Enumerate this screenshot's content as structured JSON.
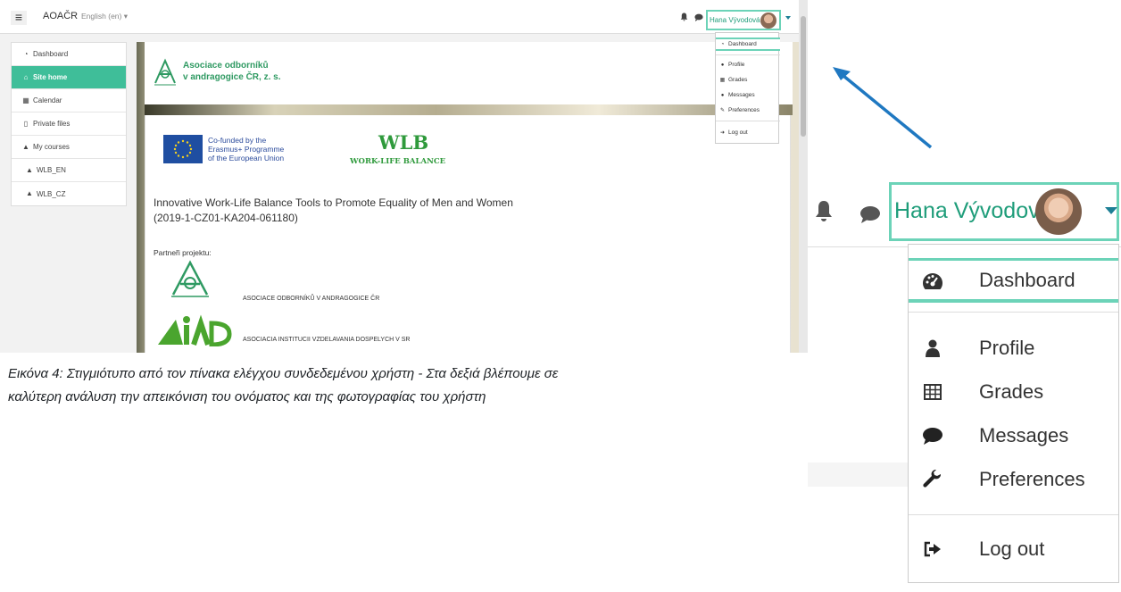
{
  "navbar": {
    "menu_icon": "hamburger-icon",
    "site_name": "AOAČR",
    "language": "English (en) ▾",
    "user_name": "Hana Vývodová",
    "icons": [
      "bell-icon",
      "chat-icon",
      "chevron-down-icon"
    ]
  },
  "sidebar": {
    "items": [
      {
        "label": "Dashboard",
        "icon": "dashboard-icon",
        "active": false
      },
      {
        "label": "Site home",
        "icon": "home-icon",
        "active": true
      },
      {
        "label": "Calendar",
        "icon": "calendar-icon",
        "active": false
      },
      {
        "label": "Private files",
        "icon": "file-icon",
        "active": false
      },
      {
        "label": "My courses",
        "icon": "graduation-cap-icon",
        "active": false
      },
      {
        "label": "WLB_EN",
        "icon": "graduation-cap-icon",
        "active": false
      },
      {
        "label": "WLB_CZ",
        "icon": "graduation-cap-icon",
        "active": false
      }
    ]
  },
  "banner": {
    "org_line1": "Asociace odborníků",
    "org_line2": "v andragogice ČR, z. s."
  },
  "content": {
    "eu_line1": "Co-funded by the",
    "eu_line2": "Erasmus+ Programme",
    "eu_line3": "of the European Union",
    "wlb_title": "WLB",
    "wlb_subtitle": "WORK-LIFE BALANCE",
    "course_title": "Innovative Work-Life Balance Tools to Promote Equality of Men and Women",
    "course_code": "(2019-1-CZ01-KA204-061180)",
    "partners_label": "Partneři projektu:",
    "partner1": "ASOCIACE ODBORNÍKŮ V ANDRAGOGICE ČR",
    "partner2": "ASOCIACIA INSTITUCII VZDELAVANIA DOSPELYCH V SR"
  },
  "user_menu": {
    "dashboard": "Dashboard",
    "profile": "Profile",
    "grades": "Grades",
    "messages": "Messages",
    "preferences": "Preferences",
    "logout": "Log out"
  },
  "caption": {
    "line1": "Εικόνα 4: Στιγμιότυπο από τον πίνακα ελέγχου συνδεδεμένου χρήστη - Στα δεξιά βλέπουμε σε",
    "line2": "καλύτερη ανάλυση την απεικόνιση του ονόματος και της φωτογραφίας του χρήστη"
  },
  "colors": {
    "accent": "#3fbe99",
    "highlight_border": "#6cd3b8",
    "link": "#1f9d7a",
    "arrow": "#1f78c1"
  }
}
